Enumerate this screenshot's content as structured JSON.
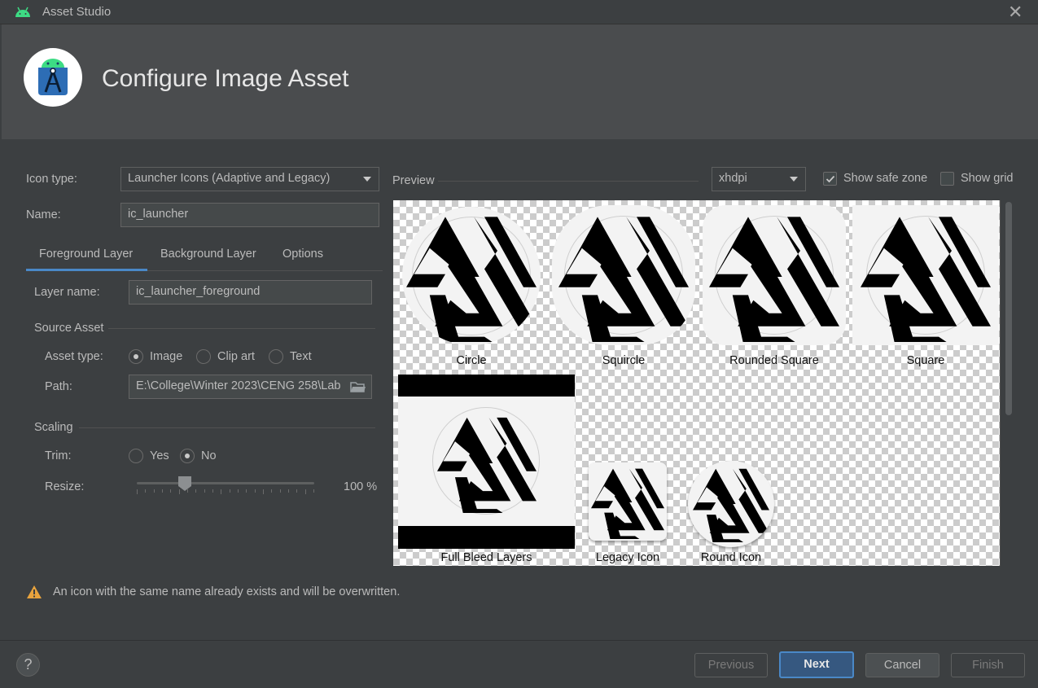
{
  "window": {
    "title": "Asset Studio",
    "close_icon": "close-icon"
  },
  "header": {
    "title": "Configure Image Asset",
    "logo_icon": "android-studio-logo-icon"
  },
  "form": {
    "icon_type_label": "Icon type:",
    "icon_type_value": "Launcher Icons (Adaptive and Legacy)",
    "name_label": "Name:",
    "name_value": "ic_launcher"
  },
  "tabs": [
    {
      "label": "Foreground Layer",
      "selected": true
    },
    {
      "label": "Background Layer",
      "selected": false
    },
    {
      "label": "Options",
      "selected": false
    }
  ],
  "foreground": {
    "layer_name_label": "Layer name:",
    "layer_name_value": "ic_launcher_foreground",
    "source_asset_heading": "Source Asset",
    "asset_type_label": "Asset type:",
    "asset_type_options": [
      "Image",
      "Clip art",
      "Text"
    ],
    "asset_type_selected": "Image",
    "path_label": "Path:",
    "path_value": "E:\\College\\Winter 2023\\CENG 258\\Lab",
    "scaling_heading": "Scaling",
    "trim_label": "Trim:",
    "trim_options": [
      "Yes",
      "No"
    ],
    "trim_selected": "No",
    "resize_label": "Resize:",
    "resize_value": "100 %",
    "resize_percent": 25
  },
  "preview": {
    "label": "Preview",
    "density": "xhdpi",
    "show_safe_zone_label": "Show safe zone",
    "show_safe_zone_checked": true,
    "show_grid_label": "Show grid",
    "show_grid_checked": false,
    "items": [
      "Circle",
      "Squircle",
      "Rounded Square",
      "Square",
      "Full Bleed Layers",
      "Legacy Icon",
      "Round Icon"
    ]
  },
  "warning": {
    "icon": "warning-icon",
    "text": "An icon with the same name already exists and will be overwritten."
  },
  "buttons": {
    "help": "?",
    "previous": "Previous",
    "next": "Next",
    "cancel": "Cancel",
    "finish": "Finish"
  }
}
